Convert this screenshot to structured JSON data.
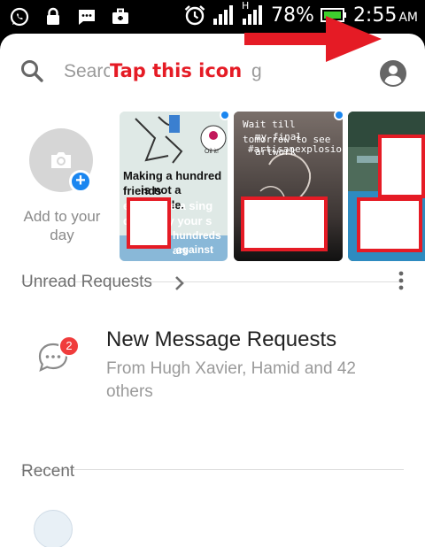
{
  "status_bar": {
    "network_badge": "H",
    "battery_percent": "78%",
    "time": "2:55",
    "ampm": "AM",
    "left_icons": [
      "whatsapp-icon",
      "lock-icon",
      "message-icon",
      "briefcase-icon"
    ],
    "right_icons": [
      "alarm-icon",
      "signal-icon",
      "signal-icon",
      "battery-icon"
    ]
  },
  "search": {
    "placeholder": "Search",
    "trailing_text": "g"
  },
  "annotation": {
    "text": "Tap this icon",
    "color": "#e51b25"
  },
  "stories": {
    "add_label": "Add to your day",
    "cards": [
      {
        "text_lines": [
          "Making a hundred friends",
          "is not a miracle.",
          "e  to make a sing",
          "d  tand by your s",
          "hundreds are",
          "against you."
        ],
        "badge_text": "Oil it!"
      },
      {
        "text_lines": [
          "Wait till tomorrow to see",
          "my final artwork",
          "#artisanexplosion"
        ]
      },
      {
        "text_lines": []
      }
    ]
  },
  "unread_requests": {
    "header": "Unread Requests",
    "item": {
      "badge_count": "2",
      "title": "New Message Requests",
      "subtitle": "From Hugh Xavier, Hamid and 42 others"
    }
  },
  "recent": {
    "header": "Recent"
  },
  "colors": {
    "accent_blue": "#1a86f0",
    "badge_red": "#f03c3c",
    "panel_bg": "#ffffff",
    "status_bg": "#000000"
  }
}
